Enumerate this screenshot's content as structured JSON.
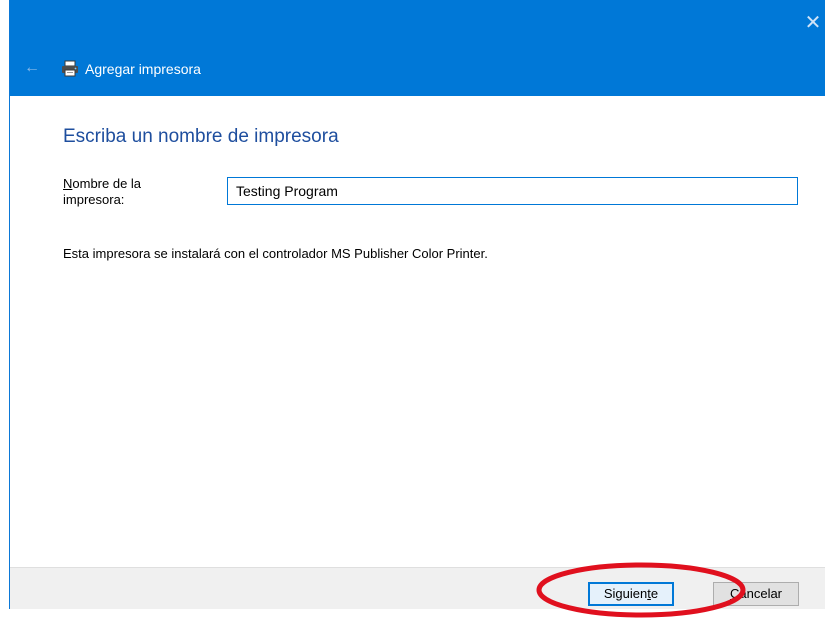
{
  "window": {
    "title": "Agregar impresora",
    "close_glyph": "✕",
    "back_glyph": "←",
    "icons": [
      "close-icon",
      "back-arrow-icon",
      "printer-icon"
    ]
  },
  "page": {
    "heading": "Escriba un nombre de impresora",
    "field_label_first": "N",
    "field_label_rest": "ombre de la impresora:",
    "printer_name_value": "Testing Program",
    "info": "Esta impresora se instalará con el controlador MS Publisher Color Printer."
  },
  "footer": {
    "next_label_a": "Siguien",
    "next_label_u": "t",
    "next_label_b": "e",
    "cancel_label_u": "C",
    "cancel_label_b": "ancelar"
  },
  "annotation": {
    "color": "#e0101e",
    "shape": "ellipse",
    "target": "Siguiente"
  },
  "colors": {
    "accent": "#0078d7",
    "heading": "#1e4e9e",
    "footer_bg": "#f0f0f0"
  }
}
